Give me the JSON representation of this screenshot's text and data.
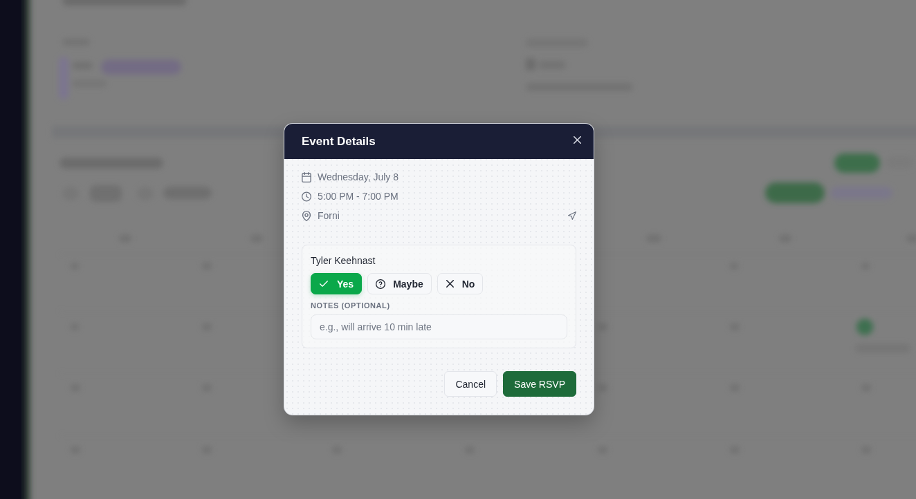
{
  "dialog": {
    "title": "Event Details",
    "details": [
      {
        "kind": "date",
        "text": "Wednesday, July 8"
      },
      {
        "kind": "time",
        "text": "5:00 PM - 7:00 PM"
      },
      {
        "kind": "location",
        "text": "Forni"
      }
    ],
    "rsvp": {
      "name": "Tyler Keehnast",
      "options": [
        {
          "kind": "yes",
          "label": "Yes",
          "selected": true
        },
        {
          "kind": "maybe",
          "label": "Maybe",
          "selected": false
        },
        {
          "kind": "no",
          "label": "No",
          "selected": false
        }
      ],
      "notes": {
        "label": "NOTES (OPTIONAL)",
        "placeholder": "e.g., will arrive 10 min late"
      }
    },
    "buttons": [
      {
        "kind": "secondary",
        "label": "Cancel"
      },
      {
        "kind": "primary",
        "label": "Save RSVP"
      }
    ]
  }
}
